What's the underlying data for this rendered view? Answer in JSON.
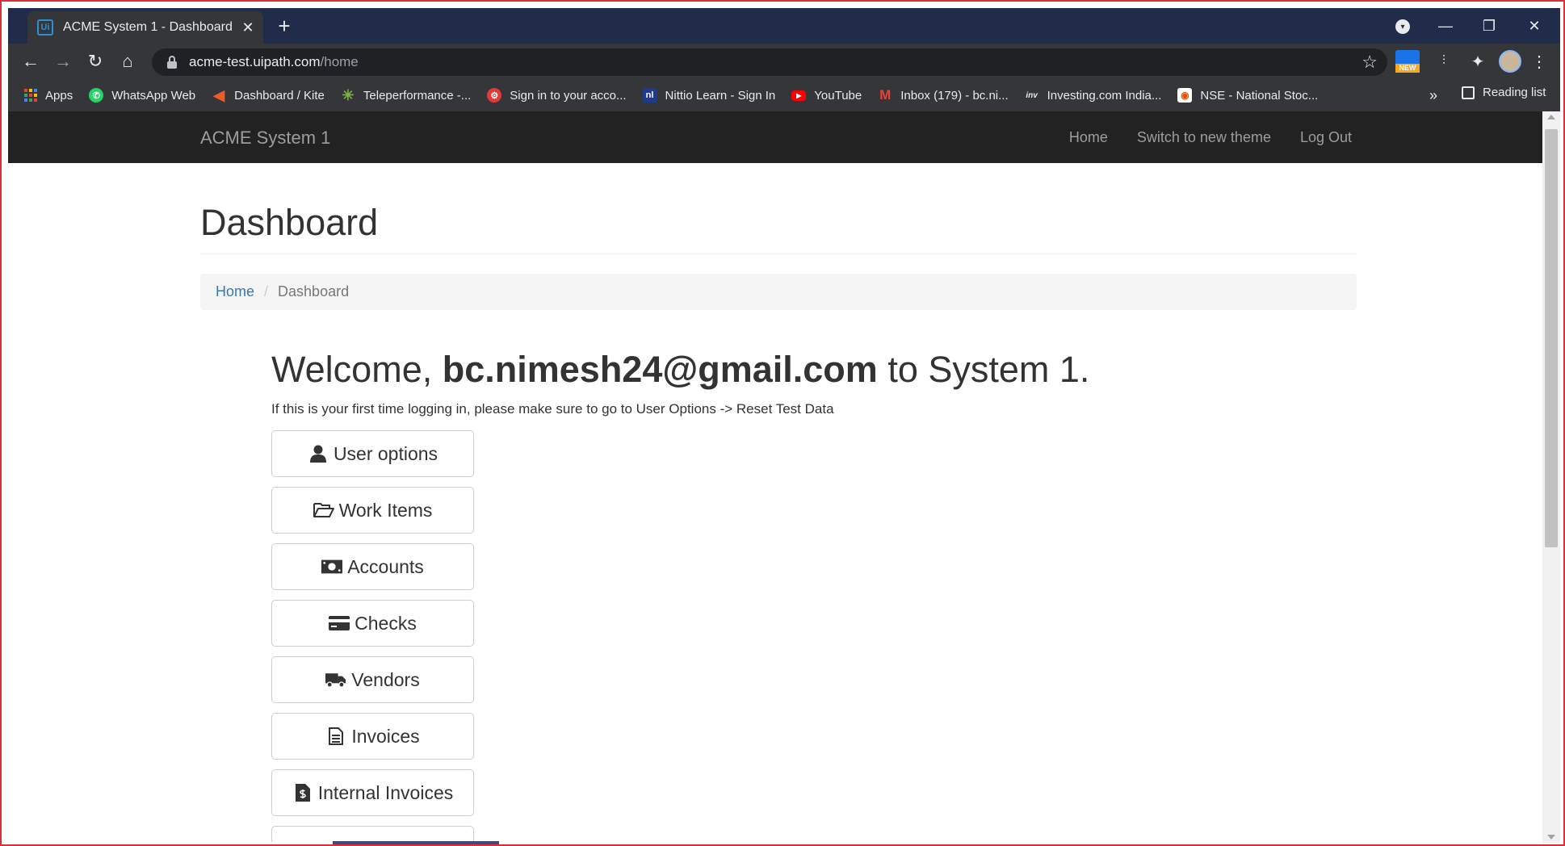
{
  "browser": {
    "tab_title": "ACME System 1 - Dashboard",
    "tab_favicon_text": "Ui",
    "url_host": "acme-test.uipath.com",
    "url_path": "/home",
    "ext_new_badge": "NEW"
  },
  "bookmarks": [
    {
      "label": "Apps",
      "icon": "apps-grid-icon"
    },
    {
      "label": "WhatsApp Web",
      "icon": "whatsapp-icon",
      "color": "#25d366"
    },
    {
      "label": "Dashboard / Kite",
      "icon": "kite-icon",
      "color": "#ef5b25"
    },
    {
      "label": "Teleperformance -...",
      "icon": "teleperformance-icon",
      "color": "#7cb342"
    },
    {
      "label": "Sign in to your acco...",
      "icon": "sign-in-icon",
      "color": "#e53935"
    },
    {
      "label": "Nittio Learn - Sign In",
      "icon": "nittio-icon",
      "color": "#1e3a8a"
    },
    {
      "label": "YouTube",
      "icon": "youtube-icon",
      "color": "#ff0000"
    },
    {
      "label": "Inbox (179) - bc.ni...",
      "icon": "gmail-icon",
      "color": "#ea4335"
    },
    {
      "label": "Investing.com India...",
      "icon": "investing-icon",
      "color": "#333333"
    },
    {
      "label": "NSE - National Stoc...",
      "icon": "nse-icon",
      "color": "#e65100"
    }
  ],
  "bookmark_icon_text": {
    "nittio": "nl",
    "investing": "inv"
  },
  "bookmarks_more": "»",
  "reading_list": "Reading list",
  "app": {
    "brand": "ACME System 1",
    "nav": [
      "Home",
      "Switch to new theme",
      "Log Out"
    ],
    "page_title": "Dashboard",
    "breadcrumb": {
      "home": "Home",
      "separator": "/",
      "current": "Dashboard"
    },
    "welcome_prefix": "Welcome,",
    "welcome_user": "bc.nimesh24@gmail.com",
    "welcome_suffix": "to System 1.",
    "hint": "If this is your first time logging in, please make sure to go to User Options -> Reset Test Data",
    "buttons": [
      {
        "label": "User options",
        "icon": "user-icon"
      },
      {
        "label": "Work Items",
        "icon": "folder-open-icon"
      },
      {
        "label": "Accounts",
        "icon": "money-icon"
      },
      {
        "label": "Checks",
        "icon": "credit-card-icon"
      },
      {
        "label": "Vendors",
        "icon": "truck-icon"
      },
      {
        "label": "Invoices",
        "icon": "file-text-icon"
      },
      {
        "label": "Internal Invoices",
        "icon": "file-dollar-icon"
      }
    ]
  }
}
